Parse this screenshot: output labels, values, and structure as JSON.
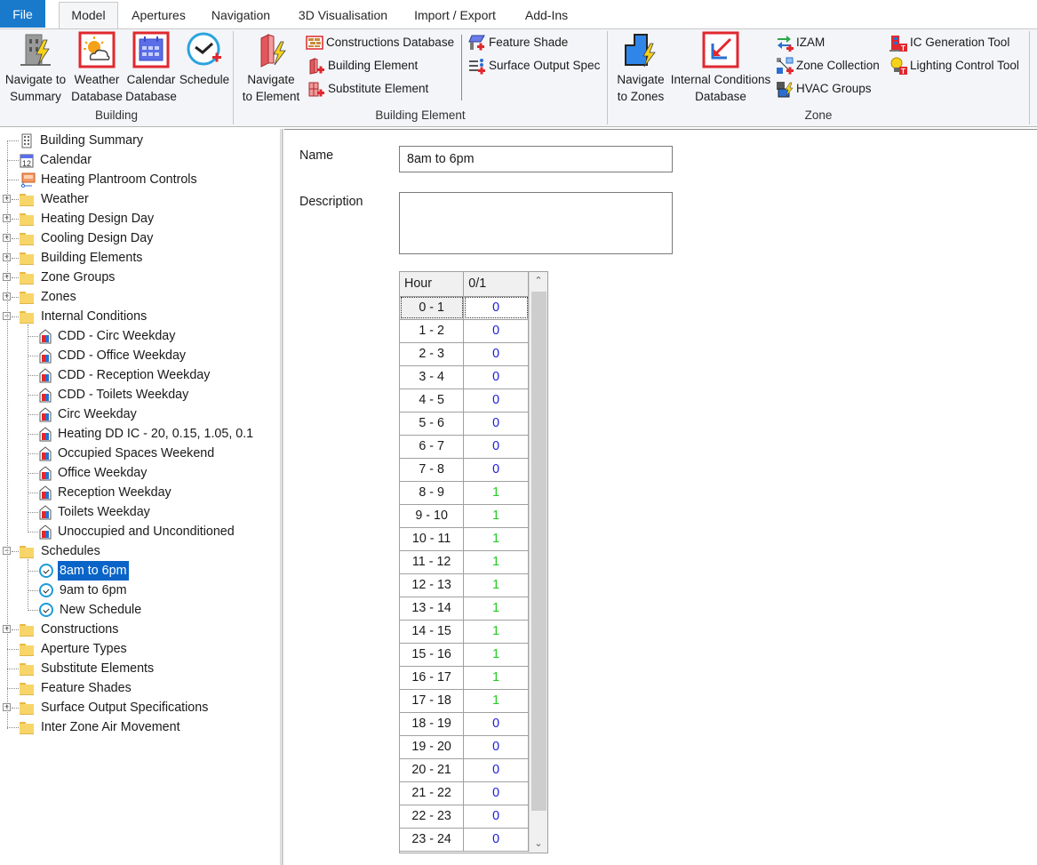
{
  "tabs": {
    "file": "File",
    "items": [
      "Model",
      "Apertures",
      "Navigation",
      "3D Visualisation",
      "Import / Export",
      "Add-Ins"
    ],
    "active": "Model"
  },
  "ribbon": {
    "groups": {
      "building": {
        "label": "Building",
        "buttons": {
          "navigate_summary": [
            "Navigate to",
            "Summary"
          ],
          "weather_db": [
            "Weather",
            "Database"
          ],
          "calendar_db": [
            "Calendar",
            "Database"
          ],
          "schedule": [
            "Schedule"
          ]
        }
      },
      "building_element": {
        "label": "Building Element",
        "navigate_element": [
          "Navigate",
          "to Element"
        ],
        "constructions_db": "Constructions Database",
        "building_element": "Building Element",
        "substitute_element": "Substitute Element",
        "feature_shade": "Feature Shade",
        "surface_output_spec": "Surface Output Spec"
      },
      "zone": {
        "label": "Zone",
        "navigate_zones": [
          "Navigate",
          "to Zones"
        ],
        "ic_database": [
          "Internal Conditions",
          "Database"
        ],
        "izam": "IZAM",
        "zone_collection": "Zone Collection",
        "hvac_groups": "HVAC Groups",
        "ic_generation_tool": "IC Generation Tool",
        "lighting_control_tool": "Lighting Control Tool"
      }
    }
  },
  "tree": {
    "items": [
      {
        "label": "Building Summary",
        "icon": "building-icon",
        "level": 0,
        "expander": "none"
      },
      {
        "label": "Calendar",
        "icon": "calendar-icon",
        "level": 0,
        "expander": "none"
      },
      {
        "label": "Heating Plantroom Controls",
        "icon": "plantroom-icon",
        "level": 0,
        "expander": "none"
      },
      {
        "label": "Weather",
        "icon": "folder-icon",
        "level": 0,
        "expander": "plus"
      },
      {
        "label": "Heating Design Day",
        "icon": "folder-icon",
        "level": 0,
        "expander": "plus"
      },
      {
        "label": "Cooling Design Day",
        "icon": "folder-icon",
        "level": 0,
        "expander": "plus"
      },
      {
        "label": "Building Elements",
        "icon": "folder-icon",
        "level": 0,
        "expander": "plus"
      },
      {
        "label": "Zone Groups",
        "icon": "folder-icon",
        "level": 0,
        "expander": "plus"
      },
      {
        "label": "Zones",
        "icon": "folder-icon",
        "level": 0,
        "expander": "plus"
      },
      {
        "label": "Internal Conditions",
        "icon": "folder-icon",
        "level": 0,
        "expander": "minus"
      },
      {
        "label": "CDD - Circ Weekday",
        "icon": "internal-condition-icon",
        "level": 1
      },
      {
        "label": "CDD - Office Weekday",
        "icon": "internal-condition-icon",
        "level": 1
      },
      {
        "label": "CDD - Reception Weekday",
        "icon": "internal-condition-icon",
        "level": 1
      },
      {
        "label": "CDD - Toilets Weekday",
        "icon": "internal-condition-icon",
        "level": 1
      },
      {
        "label": "Circ Weekday",
        "icon": "internal-condition-icon",
        "level": 1
      },
      {
        "label": "Heating DD IC - 20, 0.15, 1.05, 0.1",
        "icon": "internal-condition-icon",
        "level": 1
      },
      {
        "label": "Occupied Spaces Weekend",
        "icon": "internal-condition-icon",
        "level": 1
      },
      {
        "label": "Office Weekday",
        "icon": "internal-condition-icon",
        "level": 1
      },
      {
        "label": "Reception Weekday",
        "icon": "internal-condition-icon",
        "level": 1
      },
      {
        "label": "Toilets Weekday",
        "icon": "internal-condition-icon",
        "level": 1
      },
      {
        "label": "Unoccupied and Unconditioned",
        "icon": "internal-condition-icon",
        "level": 1
      },
      {
        "label": "Schedules",
        "icon": "folder-icon",
        "level": 0,
        "expander": "minus"
      },
      {
        "label": "8am to 6pm",
        "icon": "schedule-clock-icon",
        "level": 1,
        "selected": true
      },
      {
        "label": "9am to 6pm",
        "icon": "schedule-clock-icon",
        "level": 1
      },
      {
        "label": "New Schedule",
        "icon": "schedule-clock-icon",
        "level": 1
      },
      {
        "label": "Constructions",
        "icon": "folder-icon",
        "level": 0,
        "expander": "plus"
      },
      {
        "label": "Aperture Types",
        "icon": "folder-icon",
        "level": 0,
        "expander": "none"
      },
      {
        "label": "Substitute Elements",
        "icon": "folder-icon",
        "level": 0,
        "expander": "none"
      },
      {
        "label": "Feature Shades",
        "icon": "folder-icon",
        "level": 0,
        "expander": "none"
      },
      {
        "label": "Surface Output Specifications",
        "icon": "folder-icon",
        "level": 0,
        "expander": "plus"
      },
      {
        "label": "Inter Zone Air Movement",
        "icon": "folder-icon",
        "level": 0,
        "expander": "none"
      }
    ]
  },
  "form": {
    "name_label": "Name",
    "name_value": "8am to 6pm",
    "description_label": "Description",
    "description_value": ""
  },
  "schedule_grid": {
    "columns": [
      "Hour",
      "0/1"
    ],
    "rows": [
      {
        "hour": "0 - 1",
        "value": "0"
      },
      {
        "hour": "1 - 2",
        "value": "0"
      },
      {
        "hour": "2 - 3",
        "value": "0"
      },
      {
        "hour": "3 - 4",
        "value": "0"
      },
      {
        "hour": "4 - 5",
        "value": "0"
      },
      {
        "hour": "5 - 6",
        "value": "0"
      },
      {
        "hour": "6 - 7",
        "value": "0"
      },
      {
        "hour": "7 - 8",
        "value": "0"
      },
      {
        "hour": "8 - 9",
        "value": "1"
      },
      {
        "hour": "9 - 10",
        "value": "1"
      },
      {
        "hour": "10 - 11",
        "value": "1"
      },
      {
        "hour": "11 - 12",
        "value": "1"
      },
      {
        "hour": "12 - 13",
        "value": "1"
      },
      {
        "hour": "13 - 14",
        "value": "1"
      },
      {
        "hour": "14 - 15",
        "value": "1"
      },
      {
        "hour": "15 - 16",
        "value": "1"
      },
      {
        "hour": "16 - 17",
        "value": "1"
      },
      {
        "hour": "17 - 18",
        "value": "1"
      },
      {
        "hour": "18 - 19",
        "value": "0"
      },
      {
        "hour": "19 - 20",
        "value": "0"
      },
      {
        "hour": "20 - 21",
        "value": "0"
      },
      {
        "hour": "21 - 22",
        "value": "0"
      },
      {
        "hour": "22 - 23",
        "value": "0"
      },
      {
        "hour": "23 - 24",
        "value": "0"
      }
    ],
    "value_colors": {
      "0": "#1a1adc",
      "1": "#22cc22"
    }
  },
  "colors": {
    "file_tab": "#1979ca",
    "selection": "#0a64c8",
    "ribbon_bg": "#f3f5f8"
  }
}
